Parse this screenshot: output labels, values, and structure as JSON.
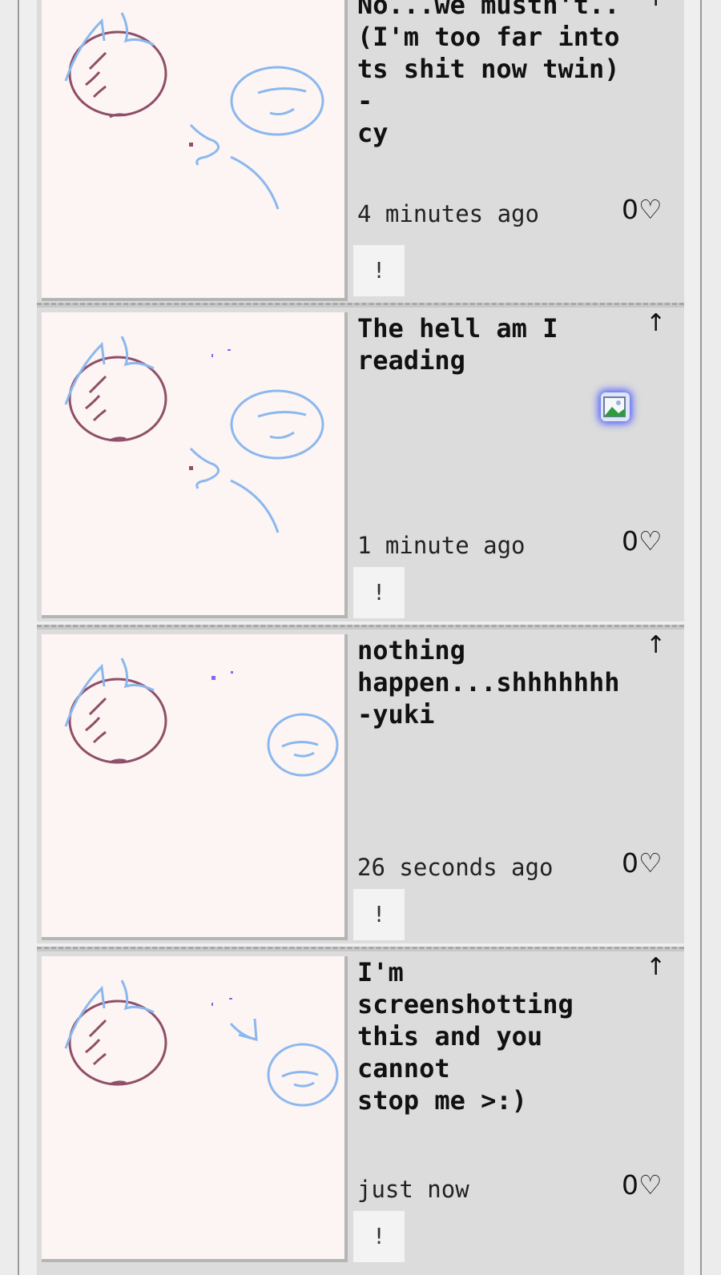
{
  "posts": [
    {
      "message": "No...we mustn't..\n(I'm too far into\nts shit now twin) -\ncy",
      "time": "4 minutes ago",
      "likes": "0♡",
      "reply_icon": "↑",
      "report_label": "!"
    },
    {
      "message": "The hell am I\nreading",
      "time": "1 minute ago",
      "likes": "0♡",
      "reply_icon": "↑",
      "report_label": "!"
    },
    {
      "message": "nothing\nhappen...shhhhhhh\n-yuki",
      "time": "26 seconds ago",
      "likes": "0♡",
      "reply_icon": "↑",
      "report_label": "!"
    },
    {
      "message": "I'm\nscreenshotting\nthis and you cannot\nstop me >:)",
      "time": "just now",
      "likes": "0♡",
      "reply_icon": "↑",
      "report_label": "!"
    }
  ],
  "colors": {
    "drawing_bg": "#fdf4f4",
    "maroon_stroke": "#8e4f68",
    "blue_stroke": "#8ab8ee",
    "purple_dot": "#7a6cf0",
    "post_bg": "#dcdcdc"
  },
  "icons": {
    "reply": "arrow-up-icon",
    "like": "heart-icon",
    "broken_image": "broken-image-icon"
  }
}
